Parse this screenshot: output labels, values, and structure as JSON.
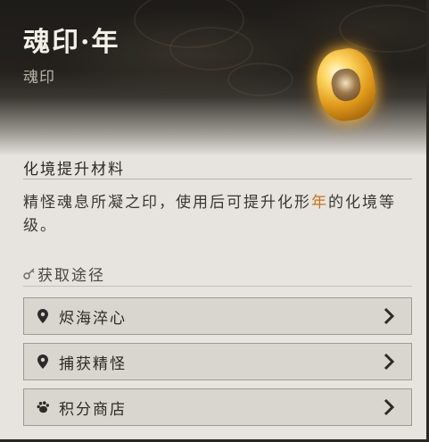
{
  "item": {
    "title": "魂印·年",
    "subtitle": "魂印",
    "icon": "soul-seal-icon"
  },
  "material": {
    "heading": "化境提升材料",
    "description_prefix": "精怪魂息所凝之印，使用后可提升化形",
    "description_highlight": "年",
    "description_suffix": "的化境等级。",
    "highlight_color": "#c8741e"
  },
  "sources": {
    "label": "获取途径",
    "icon": "key-icon",
    "items": [
      {
        "label": "烬海淬心",
        "icon": "location-pin-icon"
      },
      {
        "label": "捕获精怪",
        "icon": "location-pin-icon"
      },
      {
        "label": "积分商店",
        "icon": "paw-icon"
      }
    ]
  }
}
